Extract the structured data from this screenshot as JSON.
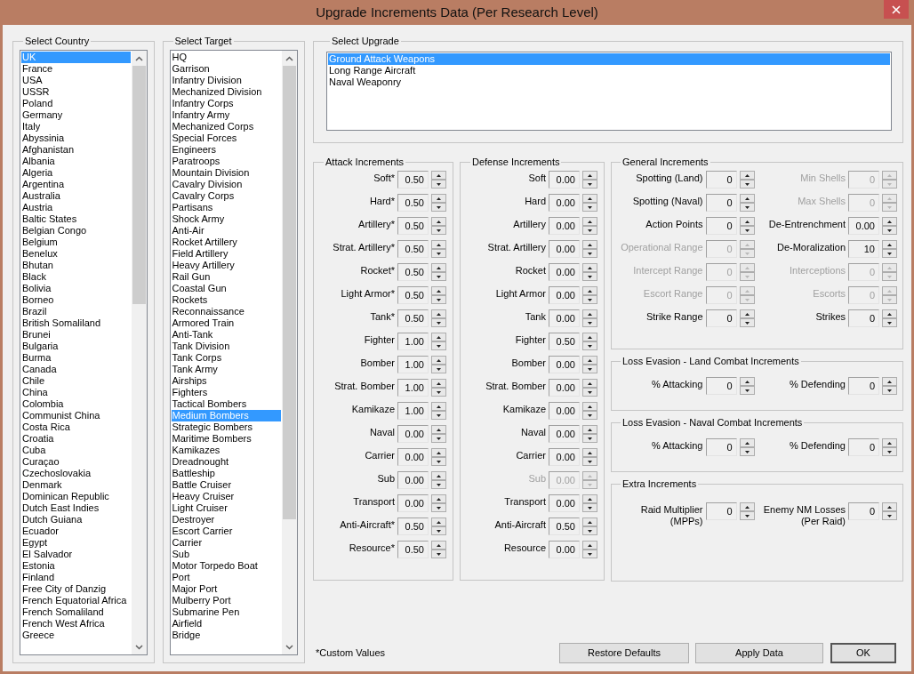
{
  "window": {
    "title": "Upgrade Increments Data (Per Research Level)"
  },
  "country_list": {
    "legend": "Select Country",
    "items": [
      {
        "label": "UK",
        "selected": true
      },
      {
        "label": "France",
        "selected": false
      },
      {
        "label": "USA",
        "selected": false
      },
      {
        "label": "USSR",
        "selected": false
      },
      {
        "label": "Poland",
        "selected": false
      },
      {
        "label": "Germany",
        "selected": false
      },
      {
        "label": "Italy",
        "selected": false
      },
      {
        "label": "Abyssinia",
        "selected": false
      },
      {
        "label": "Afghanistan",
        "selected": false
      },
      {
        "label": "Albania",
        "selected": false
      },
      {
        "label": "Algeria",
        "selected": false
      },
      {
        "label": "Argentina",
        "selected": false
      },
      {
        "label": "Australia",
        "selected": false
      },
      {
        "label": "Austria",
        "selected": false
      },
      {
        "label": "Baltic States",
        "selected": false
      },
      {
        "label": "Belgian Congo",
        "selected": false
      },
      {
        "label": "Belgium",
        "selected": false
      },
      {
        "label": "Benelux",
        "selected": false
      },
      {
        "label": "Bhutan",
        "selected": false
      },
      {
        "label": "Black",
        "selected": false
      },
      {
        "label": "Bolivia",
        "selected": false
      },
      {
        "label": "Borneo",
        "selected": false
      },
      {
        "label": "Brazil",
        "selected": false
      },
      {
        "label": "British Somaliland",
        "selected": false
      },
      {
        "label": "Brunei",
        "selected": false
      },
      {
        "label": "Bulgaria",
        "selected": false
      },
      {
        "label": "Burma",
        "selected": false
      },
      {
        "label": "Canada",
        "selected": false
      },
      {
        "label": "Chile",
        "selected": false
      },
      {
        "label": "China",
        "selected": false
      },
      {
        "label": "Colombia",
        "selected": false
      },
      {
        "label": "Communist China",
        "selected": false
      },
      {
        "label": "Costa Rica",
        "selected": false
      },
      {
        "label": "Croatia",
        "selected": false
      },
      {
        "label": "Cuba",
        "selected": false
      },
      {
        "label": "Curaçao",
        "selected": false
      },
      {
        "label": "Czechoslovakia",
        "selected": false
      },
      {
        "label": "Denmark",
        "selected": false
      },
      {
        "label": "Dominican Republic",
        "selected": false
      },
      {
        "label": "Dutch East Indies",
        "selected": false
      },
      {
        "label": "Dutch Guiana",
        "selected": false
      },
      {
        "label": "Ecuador",
        "selected": false
      },
      {
        "label": "Egypt",
        "selected": false
      },
      {
        "label": "El Salvador",
        "selected": false
      },
      {
        "label": "Estonia",
        "selected": false
      },
      {
        "label": "Finland",
        "selected": false
      },
      {
        "label": "Free City of Danzig",
        "selected": false
      },
      {
        "label": "French Equatorial Africa",
        "selected": false
      },
      {
        "label": "French Somaliland",
        "selected": false
      },
      {
        "label": "French West Africa",
        "selected": false
      },
      {
        "label": "Greece",
        "selected": false
      }
    ]
  },
  "target_list": {
    "legend": "Select Target",
    "items": [
      {
        "label": "HQ",
        "selected": false
      },
      {
        "label": "Garrison",
        "selected": false
      },
      {
        "label": "Infantry Division",
        "selected": false
      },
      {
        "label": "Mechanized Division",
        "selected": false
      },
      {
        "label": "Infantry Corps",
        "selected": false
      },
      {
        "label": "Infantry Army",
        "selected": false
      },
      {
        "label": "Mechanized Corps",
        "selected": false
      },
      {
        "label": "Special Forces",
        "selected": false
      },
      {
        "label": "Engineers",
        "selected": false
      },
      {
        "label": "Paratroops",
        "selected": false
      },
      {
        "label": "Mountain Division",
        "selected": false
      },
      {
        "label": "Cavalry Division",
        "selected": false
      },
      {
        "label": "Cavalry Corps",
        "selected": false
      },
      {
        "label": "Partisans",
        "selected": false
      },
      {
        "label": "Shock Army",
        "selected": false
      },
      {
        "label": "Anti-Air",
        "selected": false
      },
      {
        "label": "Rocket Artillery",
        "selected": false
      },
      {
        "label": "Field Artillery",
        "selected": false
      },
      {
        "label": "Heavy Artillery",
        "selected": false
      },
      {
        "label": "Rail Gun",
        "selected": false
      },
      {
        "label": "Coastal Gun",
        "selected": false
      },
      {
        "label": "Rockets",
        "selected": false
      },
      {
        "label": "Reconnaissance",
        "selected": false
      },
      {
        "label": "Armored Train",
        "selected": false
      },
      {
        "label": "Anti-Tank",
        "selected": false
      },
      {
        "label": "Tank Division",
        "selected": false
      },
      {
        "label": "Tank Corps",
        "selected": false
      },
      {
        "label": "Tank Army",
        "selected": false
      },
      {
        "label": "Airships",
        "selected": false
      },
      {
        "label": "Fighters",
        "selected": false
      },
      {
        "label": "Tactical Bombers",
        "selected": false
      },
      {
        "label": "Medium Bombers",
        "selected": true
      },
      {
        "label": "Strategic Bombers",
        "selected": false
      },
      {
        "label": "Maritime Bombers",
        "selected": false
      },
      {
        "label": "Kamikazes",
        "selected": false
      },
      {
        "label": "Dreadnought",
        "selected": false
      },
      {
        "label": "Battleship",
        "selected": false
      },
      {
        "label": "Battle Cruiser",
        "selected": false
      },
      {
        "label": "Heavy Cruiser",
        "selected": false
      },
      {
        "label": "Light Cruiser",
        "selected": false
      },
      {
        "label": "Destroyer",
        "selected": false
      },
      {
        "label": "Escort Carrier",
        "selected": false
      },
      {
        "label": "Carrier",
        "selected": false
      },
      {
        "label": "Sub",
        "selected": false
      },
      {
        "label": "Motor Torpedo Boat",
        "selected": false
      },
      {
        "label": "Port",
        "selected": false
      },
      {
        "label": "Major Port",
        "selected": false
      },
      {
        "label": "Mulberry Port",
        "selected": false
      },
      {
        "label": "Submarine Pen",
        "selected": false
      },
      {
        "label": "Airfield",
        "selected": false
      },
      {
        "label": "Bridge",
        "selected": false
      }
    ]
  },
  "upgrade_list": {
    "legend": "Select Upgrade",
    "items": [
      {
        "label": "Ground Attack Weapons",
        "selected": true
      },
      {
        "label": "Long Range Aircraft",
        "selected": false
      },
      {
        "label": "Naval Weaponry",
        "selected": false
      }
    ]
  },
  "groups": [
    {
      "legend": "Attack Increments",
      "kind": "single",
      "fields": [
        {
          "label": "Soft*",
          "value": "0.50",
          "disabled": false
        },
        {
          "label": "Hard*",
          "value": "0.50",
          "disabled": false
        },
        {
          "label": "Artillery*",
          "value": "0.50",
          "disabled": false
        },
        {
          "label": "Strat. Artillery*",
          "value": "0.50",
          "disabled": false
        },
        {
          "label": "Rocket*",
          "value": "0.50",
          "disabled": false
        },
        {
          "label": "Light Armor*",
          "value": "0.50",
          "disabled": false
        },
        {
          "label": "Tank*",
          "value": "0.50",
          "disabled": false
        },
        {
          "label": "Fighter",
          "value": "1.00",
          "disabled": false
        },
        {
          "label": "Bomber",
          "value": "1.00",
          "disabled": false
        },
        {
          "label": "Strat. Bomber",
          "value": "1.00",
          "disabled": false
        },
        {
          "label": "Kamikaze",
          "value": "1.00",
          "disabled": false
        },
        {
          "label": "Naval",
          "value": "0.00",
          "disabled": false
        },
        {
          "label": "Carrier",
          "value": "0.00",
          "disabled": false
        },
        {
          "label": "Sub",
          "value": "0.00",
          "disabled": false
        },
        {
          "label": "Transport",
          "value": "0.00",
          "disabled": false
        },
        {
          "label": "Anti-Aircraft*",
          "value": "0.50",
          "disabled": false
        },
        {
          "label": "Resource*",
          "value": "0.50",
          "disabled": false
        }
      ]
    },
    {
      "legend": "Defense Increments",
      "kind": "single",
      "fields": [
        {
          "label": "Soft",
          "value": "0.00",
          "disabled": false
        },
        {
          "label": "Hard",
          "value": "0.00",
          "disabled": false
        },
        {
          "label": "Artillery",
          "value": "0.00",
          "disabled": false
        },
        {
          "label": "Strat. Artillery",
          "value": "0.00",
          "disabled": false
        },
        {
          "label": "Rocket",
          "value": "0.00",
          "disabled": false
        },
        {
          "label": "Light Armor",
          "value": "0.00",
          "disabled": false
        },
        {
          "label": "Tank",
          "value": "0.00",
          "disabled": false
        },
        {
          "label": "Fighter",
          "value": "0.50",
          "disabled": false
        },
        {
          "label": "Bomber",
          "value": "0.00",
          "disabled": false
        },
        {
          "label": "Strat. Bomber",
          "value": "0.00",
          "disabled": false
        },
        {
          "label": "Kamikaze",
          "value": "0.00",
          "disabled": false
        },
        {
          "label": "Naval",
          "value": "0.00",
          "disabled": false
        },
        {
          "label": "Carrier",
          "value": "0.00",
          "disabled": false
        },
        {
          "label": "Sub",
          "value": "0.00",
          "disabled": true
        },
        {
          "label": "Transport",
          "value": "0.00",
          "disabled": false
        },
        {
          "label": "Anti-Aircraft",
          "value": "0.50",
          "disabled": false
        },
        {
          "label": "Resource",
          "value": "0.00",
          "disabled": false
        }
      ]
    },
    {
      "legend": "General Increments",
      "kind": "double",
      "fields": [
        {
          "label": "Spotting (Land)",
          "value": "0",
          "disabled": false
        },
        {
          "label": "Min Shells",
          "value": "0",
          "disabled": true
        },
        {
          "label": "Spotting (Naval)",
          "value": "0",
          "disabled": false
        },
        {
          "label": "Max Shells",
          "value": "0",
          "disabled": true
        },
        {
          "label": "Action Points",
          "value": "0",
          "disabled": false
        },
        {
          "label": "De-Entrenchment",
          "value": "0.00",
          "disabled": false
        },
        {
          "label": "Operational Range",
          "value": "0",
          "disabled": true
        },
        {
          "label": "De-Moralization",
          "value": "10",
          "disabled": false
        },
        {
          "label": "Intercept Range",
          "value": "0",
          "disabled": true
        },
        {
          "label": "Interceptions",
          "value": "0",
          "disabled": true
        },
        {
          "label": "Escort Range",
          "value": "0",
          "disabled": true
        },
        {
          "label": "Escorts",
          "value": "0",
          "disabled": true
        },
        {
          "label": "Strike Range",
          "value": "0",
          "disabled": false
        },
        {
          "label": "Strikes",
          "value": "0",
          "disabled": false
        }
      ]
    },
    {
      "legend": "Loss Evasion - Land Combat Increments",
      "kind": "double",
      "fields": [
        {
          "label": "% Attacking",
          "value": "0",
          "disabled": false
        },
        {
          "label": "% Defending",
          "value": "0",
          "disabled": false
        }
      ]
    },
    {
      "legend": "Loss Evasion - Naval Combat Increments",
      "kind": "double",
      "fields": [
        {
          "label": "% Attacking",
          "value": "0",
          "disabled": false
        },
        {
          "label": "% Defending",
          "value": "0",
          "disabled": false
        }
      ]
    },
    {
      "legend": "Extra Increments",
      "kind": "double",
      "fields": [
        {
          "label": "Raid Multiplier\n(MPPs)",
          "value": "0",
          "disabled": false
        },
        {
          "label": "Enemy NM Losses\n(Per Raid)",
          "value": "0",
          "disabled": false
        }
      ]
    }
  ],
  "note": "*Custom Values",
  "buttons": [
    {
      "label": "Restore Defaults",
      "default": false
    },
    {
      "label": "Apply Data",
      "default": false
    },
    {
      "label": "OK",
      "default": true
    }
  ]
}
